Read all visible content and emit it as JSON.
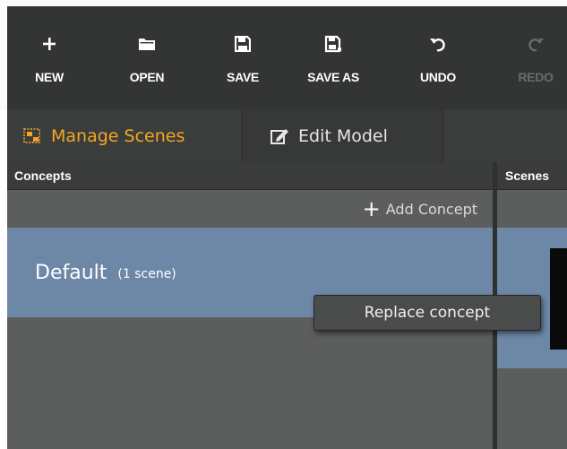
{
  "toolbar": {
    "buttons": [
      {
        "label": "NEW",
        "icon": "plus-icon",
        "enabled": true
      },
      {
        "label": "OPEN",
        "icon": "folder-icon",
        "enabled": true
      },
      {
        "label": "SAVE",
        "icon": "save-icon",
        "enabled": true
      },
      {
        "label": "SAVE AS",
        "icon": "save-as-icon",
        "enabled": true
      },
      {
        "label": "UNDO",
        "icon": "undo-icon",
        "enabled": true
      },
      {
        "label": "REDO",
        "icon": "redo-icon",
        "enabled": false
      }
    ]
  },
  "tabs": [
    {
      "label": "Manage Scenes",
      "icon": "manage-scenes-icon",
      "active": true
    },
    {
      "label": "Edit Model",
      "icon": "edit-model-icon",
      "active": false
    }
  ],
  "concepts_panel": {
    "header": "Concepts",
    "add_label": "Add Concept",
    "concepts": [
      {
        "name": "Default",
        "count": "(1 scene)",
        "selected": true
      }
    ]
  },
  "scenes_panel": {
    "header": "Scenes"
  },
  "context_menu": {
    "items": [
      "Replace concept"
    ]
  },
  "colors": {
    "accent": "#f5a623",
    "selection": "#6d87a7",
    "toolbar_bg": "#333434",
    "panel_bg": "#5c5d5d"
  }
}
